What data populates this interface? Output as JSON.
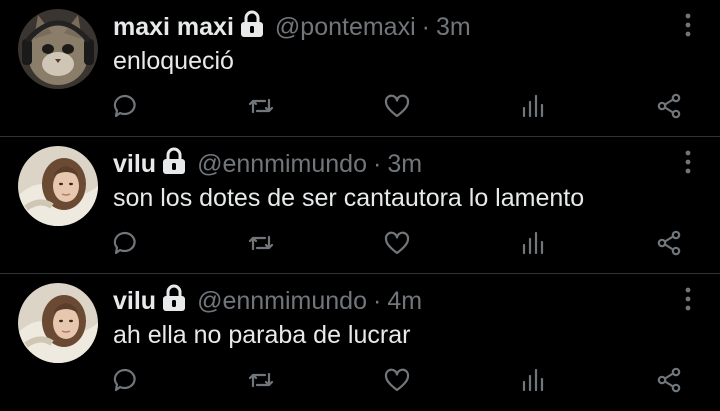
{
  "tweets": [
    {
      "name": "maxi maxi",
      "handle": "@pontemaxi",
      "separator": "·",
      "time": "3m",
      "text": "enloqueció",
      "avatar": "cat-with-headphones"
    },
    {
      "name": "vilu",
      "handle": "@ennmimundo",
      "separator": "·",
      "time": "3m",
      "text": "son los dotes de ser cantautora lo lamento",
      "avatar": "girl-lying-in-bed"
    },
    {
      "name": "vilu",
      "handle": "@ennmimundo",
      "separator": "·",
      "time": "4m",
      "text": "ah ella no paraba de lucrar",
      "avatar": "girl-lying-in-bed"
    }
  ],
  "icons": {
    "lock": "lock-icon",
    "more": "more-vertical-icon",
    "reply": "reply-icon",
    "retweet": "retweet-icon",
    "like": "like-icon",
    "views": "views-icon",
    "share": "share-icon"
  },
  "colors": {
    "background": "#000000",
    "text": "#e7e9ea",
    "secondary": "#71767b",
    "divider": "#2f3336"
  }
}
